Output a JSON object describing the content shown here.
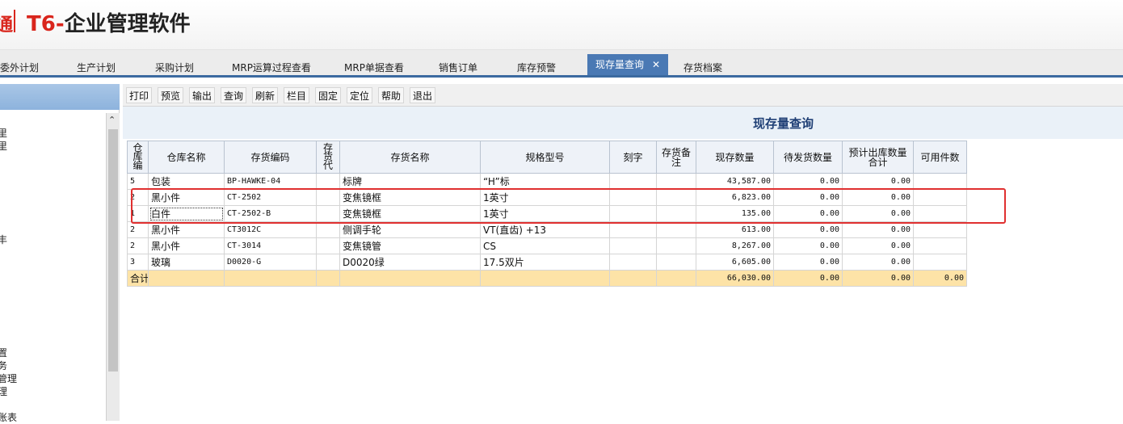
{
  "header": {
    "logo_mark": "通",
    "logo_t6": "T6",
    "logo_dash": "-",
    "logo_name": "企业管理软件"
  },
  "module_tabs": [
    {
      "label": "委外计划"
    },
    {
      "label": "生产计划"
    },
    {
      "label": "采购计划"
    },
    {
      "label": "MRP运算过程查看"
    },
    {
      "label": "MRP单据查看"
    },
    {
      "label": "销售订单"
    },
    {
      "label": "库存预警"
    },
    {
      "label": "现存量查询",
      "close": "✕"
    },
    {
      "label": "存货档案"
    }
  ],
  "left_panel": {
    "items": [
      "里",
      "里",
      "丰",
      "置",
      "务",
      "管理",
      "理",
      "账表"
    ]
  },
  "toolbar": {
    "buttons": [
      "打印",
      "预览",
      "输出",
      "查询",
      "刷新",
      "栏目",
      "固定",
      "定位",
      "帮助",
      "退出"
    ]
  },
  "page_title": "现存量查询",
  "grid": {
    "columns": [
      "仓库编",
      "仓库名称",
      "存货编码",
      "存货代",
      "存货名称",
      "规格型号",
      "刻字",
      "存货备注",
      "现存数量",
      "待发货数量",
      "预计出库数量合计",
      "可用件数"
    ],
    "rows": [
      [
        "5",
        "包装",
        "BP-HAWKE-04",
        "",
        "标牌",
        "“H”标",
        "",
        "",
        "43,587.00",
        "0.00",
        "0.00",
        ""
      ],
      [
        "2",
        "黑小件",
        "CT-2502",
        "",
        "变焦镜框",
        "1英寸",
        "",
        "",
        "6,823.00",
        "0.00",
        "0.00",
        ""
      ],
      [
        "1",
        "白件",
        "CT-2502-B",
        "",
        "变焦镜框",
        "1英寸",
        "",
        "",
        "135.00",
        "0.00",
        "0.00",
        ""
      ],
      [
        "2",
        "黑小件",
        "CT3012C",
        "",
        "侧调手轮",
        "VT(直齿) +13",
        "",
        "",
        "613.00",
        "0.00",
        "0.00",
        ""
      ],
      [
        "2",
        "黑小件",
        "CT-3014",
        "",
        "变焦镜管",
        "CS",
        "",
        "",
        "8,267.00",
        "0.00",
        "0.00",
        ""
      ],
      [
        "3",
        "玻璃",
        "D0020-G",
        "",
        "D0020绿",
        "17.5双片",
        "",
        "",
        "6,605.00",
        "0.00",
        "0.00",
        ""
      ]
    ],
    "total": {
      "label": "合计",
      "values": [
        "",
        "",
        "",
        "",
        "",
        "",
        "",
        "66,030.00",
        "0.00",
        "0.00",
        "0.00"
      ]
    }
  },
  "colors": {
    "brand": "#d9251c",
    "active_tab": "#4a79b4",
    "total_row": "#fde3a7",
    "highlight": "#e03030"
  }
}
